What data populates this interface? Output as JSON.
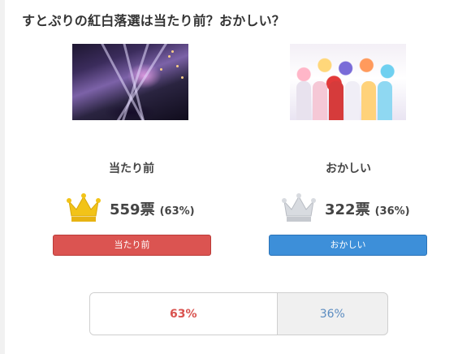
{
  "question": "すとぷりの紅白落選は当たり前？おかしい？",
  "options": [
    {
      "label": "当たり前",
      "votes": "559票",
      "percent": "(63%)",
      "button_label": "当たり前",
      "crown_color": "gold",
      "share": 0.63
    },
    {
      "label": "おかしい",
      "votes": "322票",
      "percent": "(36%)",
      "button_label": "おかしい",
      "crown_color": "silver",
      "share": 0.36
    }
  ],
  "result_bar": {
    "left_text": "63%",
    "right_text": "36%",
    "left_share": 0.63
  },
  "colors": {
    "agree": "#db5451",
    "disagree": "#3d8fd9",
    "gold": "#f2c318",
    "silver": "#cfd2d6"
  }
}
